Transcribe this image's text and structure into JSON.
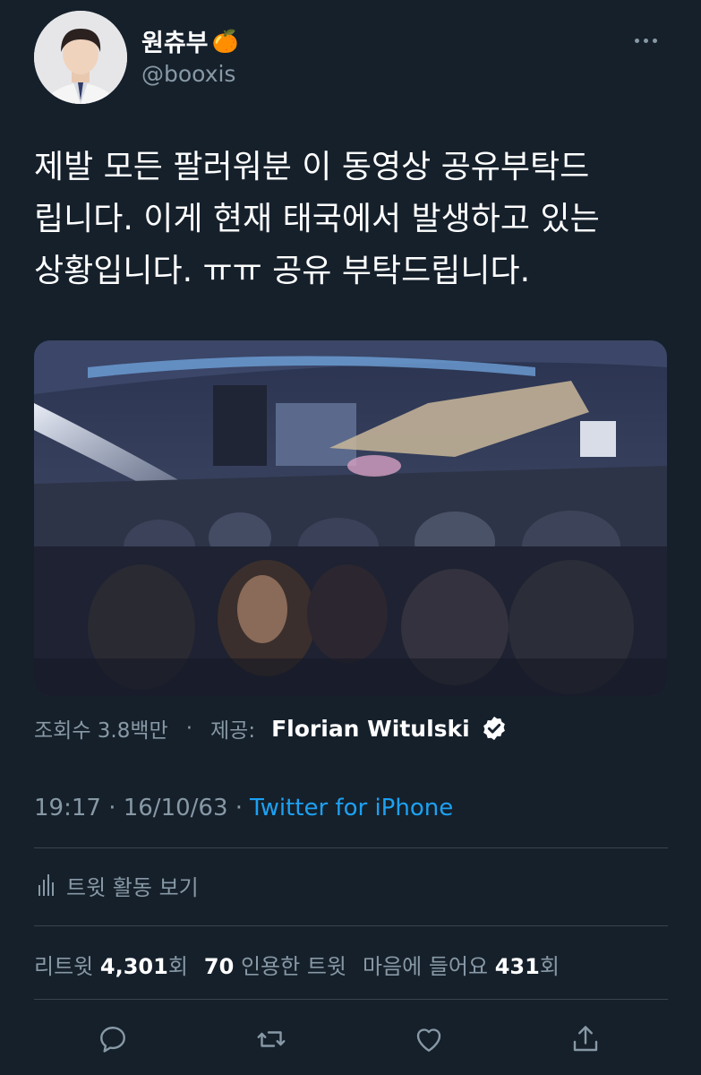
{
  "user": {
    "display_name": "원츄부",
    "emoji": "🍊",
    "handle": "@booxis"
  },
  "tweet": {
    "lines": [
      "제발 모든 팔러워분 이 동영상 공유부탁드",
      "립니다. 이게 현재 태국에서 발생하고 있는",
      "상황입니다. ㅠㅠ 공유 부탁드립니다."
    ]
  },
  "media_meta": {
    "views_label": "조회수 3.8백만",
    "separator": "·",
    "provider_label": "제공:",
    "provider_name": "Florian Witulski"
  },
  "timestamp": {
    "text": "19:17 · 16/10/63 ·",
    "source": "Twitter for iPhone"
  },
  "activity_label": "트윗 활동 보기",
  "stats": {
    "retweets_label": "리트윗",
    "retweets_count": "4,301",
    "retweets_suffix": "회",
    "quotes_count": "70",
    "quotes_label": "인용한 트윗",
    "likes_label": "마음에 들어요",
    "likes_count": "431",
    "likes_suffix": "회"
  },
  "icons": {
    "reply": "reply-icon",
    "retweet": "retweet-icon",
    "like": "heart-icon",
    "share": "share-icon",
    "more": "more-icon",
    "verified": "verified-badge-icon",
    "activity": "bar-chart-icon"
  },
  "colors": {
    "background": "#15202b",
    "secondary_text": "#8899a6",
    "link": "#1da1f2",
    "divider": "#38444d"
  }
}
